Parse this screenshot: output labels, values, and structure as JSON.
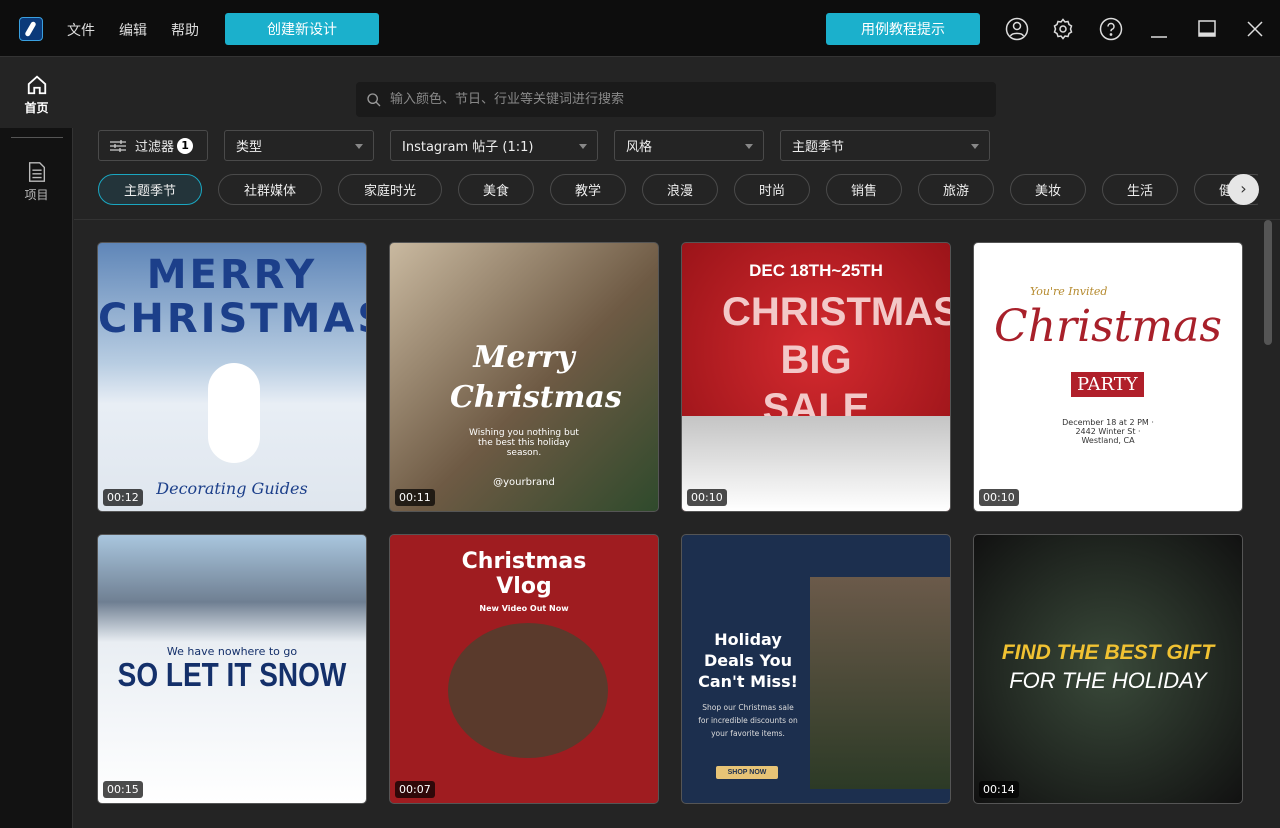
{
  "titlebar": {
    "menus": [
      "文件",
      "编辑",
      "帮助"
    ],
    "create_button": "创建新设计",
    "tutorial_button": "用例教程提示"
  },
  "sidebar": {
    "items": [
      {
        "label": "首页",
        "icon": "home-icon"
      },
      {
        "label": "项目",
        "icon": "document-icon"
      }
    ]
  },
  "search": {
    "placeholder": "输入颜色、节日、行业等关键词进行搜索",
    "value": ""
  },
  "filters": {
    "filter_label": "过滤器",
    "filter_count": "1",
    "type": "类型",
    "format": "Instagram 帖子 (1:1)",
    "style": "风格",
    "theme": "主题季节"
  },
  "chips": [
    "主题季节",
    "社群媒体",
    "家庭时光",
    "美食",
    "教学",
    "浪漫",
    "时尚",
    "销售",
    "旅游",
    "美妆",
    "生活",
    "健康"
  ],
  "templates": [
    {
      "duration": "00:12",
      "title": "MERRY CHRISTMAS",
      "sub": "Decorating Guides"
    },
    {
      "duration": "00:11",
      "title": "Merry Christmas",
      "sub": "Wishing you nothing but the best this holiday season.",
      "handle": "@yourbrand"
    },
    {
      "duration": "00:10",
      "top": "DEC 18TH~25TH",
      "title": "CHRISTMAS BIG SALE"
    },
    {
      "duration": "00:10",
      "top": "You're Invited",
      "title": "Christmas",
      "sub": "PARTY",
      "details": "December 18 at 2 PM · 2442 Winter St · Westland, CA"
    },
    {
      "duration": "00:15",
      "top": "We have nowhere to go",
      "title": "SO LET IT SNOW"
    },
    {
      "duration": "00:07",
      "title": "Christmas Vlog",
      "sub": "New Video Out Now"
    },
    {
      "duration": "",
      "title": "Holiday Deals You Can't Miss!",
      "sub": "Shop our Christmas sale for incredible discounts on your favorite items.",
      "cta": "SHOP NOW"
    },
    {
      "duration": "00:14",
      "title": "FIND THE BEST GIFT",
      "sub": "FOR THE HOLIDAY"
    }
  ]
}
